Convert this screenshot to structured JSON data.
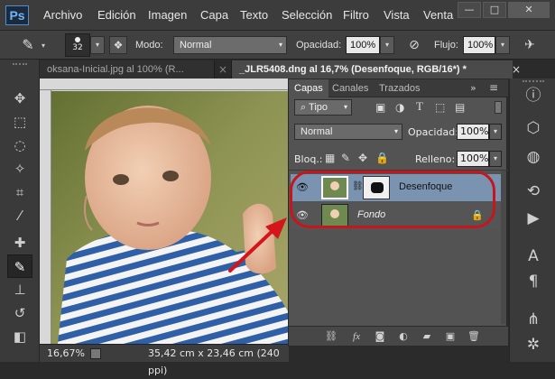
{
  "app": {
    "logo": "Ps",
    "menus": [
      "Archivo",
      "Edición",
      "Imagen",
      "Capa",
      "Texto",
      "Selección",
      "Filtro",
      "Vista",
      "Venta"
    ]
  },
  "window_controls": {
    "minimize": "—",
    "maximize": "□",
    "close": "✕"
  },
  "options_bar": {
    "brush_size": "32",
    "mode_label": "Modo:",
    "mode_value": "Normal",
    "opacity_label": "Opacidad:",
    "opacity_value": "100%",
    "flow_label": "Flujo:",
    "flow_value": "100%"
  },
  "tabs": [
    {
      "label": "oksana-Inicial.jpg al 100% (R...",
      "active": false
    },
    {
      "label": "_JLR5408.dng al 16,7% (Desenfoque, RGB/16*) *",
      "active": true
    }
  ],
  "tab_close": "×",
  "status": {
    "zoom": "16,67%",
    "doc_info": "35,42 cm x 23,46 cm (240 ppi)"
  },
  "layers_panel": {
    "tabs": [
      "Capas",
      "Canales",
      "Trazados"
    ],
    "menu_glyph": "»",
    "filter_label": "Tipo",
    "blend_mode": "Normal",
    "opacity_label": "Opacidad:",
    "opacity_value": "100%",
    "lock_label": "Bloq.:",
    "fill_label": "Relleno:",
    "fill_value": "100%",
    "layers": [
      {
        "name": "Desenfoque",
        "has_mask": true,
        "selected": true,
        "italic": false
      },
      {
        "name": "Fondo",
        "has_mask": false,
        "selected": false,
        "italic": true
      }
    ]
  },
  "colors": {
    "selected_layer": "#7a93b0",
    "highlight_oval": "#c4161c",
    "arrow": "#d4151b"
  }
}
